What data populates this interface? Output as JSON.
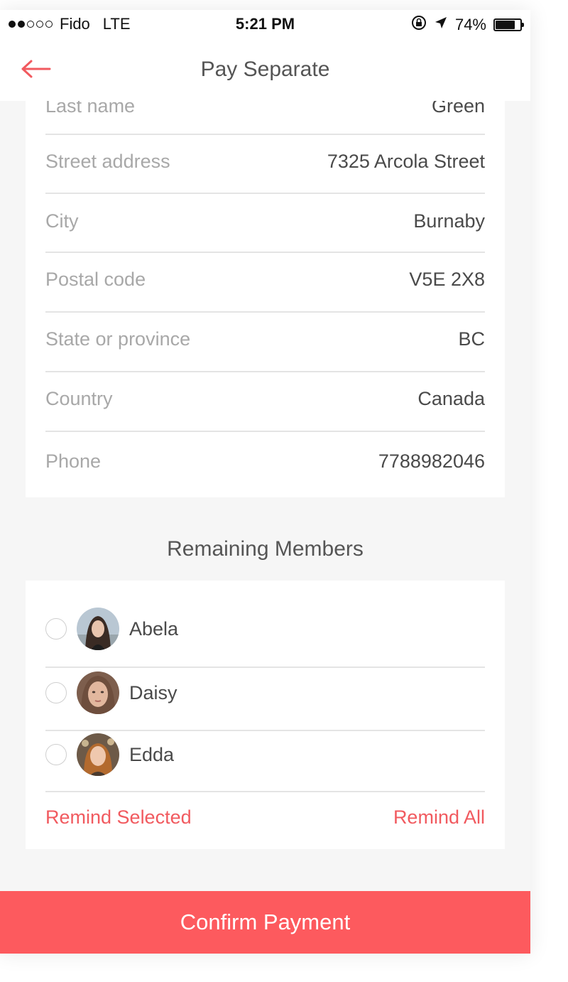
{
  "status_bar": {
    "carrier": "Fido",
    "network": "LTE",
    "time": "5:21 PM",
    "battery_percent": "74%",
    "battery_level": 0.74,
    "signal_bars_filled": 2,
    "signal_bars_total": 5,
    "icons": [
      "rotation-lock-icon",
      "location-arrow-icon",
      "battery-icon"
    ]
  },
  "nav": {
    "title": "Pay Separate",
    "back_icon": "back-arrow-icon"
  },
  "address": {
    "fields": [
      {
        "label": "Last name",
        "value": "Green"
      },
      {
        "label": "Street address",
        "value": "7325 Arcola Street"
      },
      {
        "label": "City",
        "value": "Burnaby"
      },
      {
        "label": "Postal code",
        "value": "V5E 2X8"
      },
      {
        "label": "State or province",
        "value": "BC"
      },
      {
        "label": "Country",
        "value": "Canada"
      },
      {
        "label": "Phone",
        "value": "7788982046"
      }
    ]
  },
  "members": {
    "title": "Remaining Members",
    "list": [
      {
        "name": "Abela",
        "selected": false
      },
      {
        "name": "Daisy",
        "selected": false
      },
      {
        "name": "Edda",
        "selected": false
      }
    ],
    "remind_selected": "Remind Selected",
    "remind_all": "Remind All"
  },
  "confirm_button": "Confirm Payment",
  "colors": {
    "accent": "#fd5a5e",
    "link": "#f15a5f",
    "background": "#f6f6f6"
  }
}
